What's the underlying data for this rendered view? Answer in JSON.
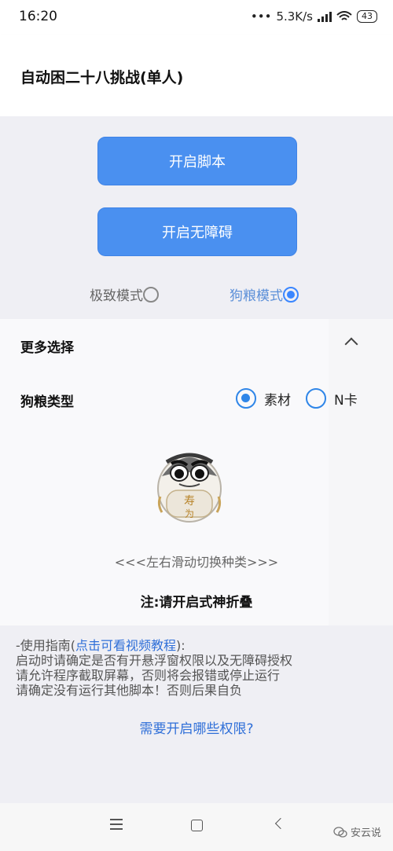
{
  "status": {
    "time": "16:20",
    "speed": "5.3K/s",
    "battery": "43"
  },
  "app": {
    "title": "自动困二十八挑战(单人)"
  },
  "buttons": {
    "start_script": "开启脚本",
    "start_accessibility": "开启无障碍"
  },
  "modes": [
    {
      "label": "极致模式",
      "selected": false
    },
    {
      "label": "狗粮模式",
      "selected": true
    }
  ],
  "more": {
    "title": "更多选择",
    "type_label": "狗粮类型",
    "options": [
      {
        "label": "素材",
        "selected": true
      },
      {
        "label": "N卡",
        "selected": false
      }
    ],
    "swipe_hint": "<<<左右滑动切换种类>>>",
    "note": "注:请开启式神折叠"
  },
  "guide": {
    "prefix": "-使用指南(",
    "link": "点击可看视频教程",
    "suffix": "):",
    "line1": "启动时请确定是否有开悬浮窗权限以及无障碍授权",
    "line2": "请允许程序截取屏幕，否则将会报错或停止运行",
    "line3": "请确定没有运行其他脚本！否则后果自负"
  },
  "permissions_link": "需要开启哪些权限?",
  "watermark": "安云说",
  "colors": {
    "accent": "#4a90f0",
    "link": "#2f6fd8",
    "radio": "#2f86e8"
  }
}
